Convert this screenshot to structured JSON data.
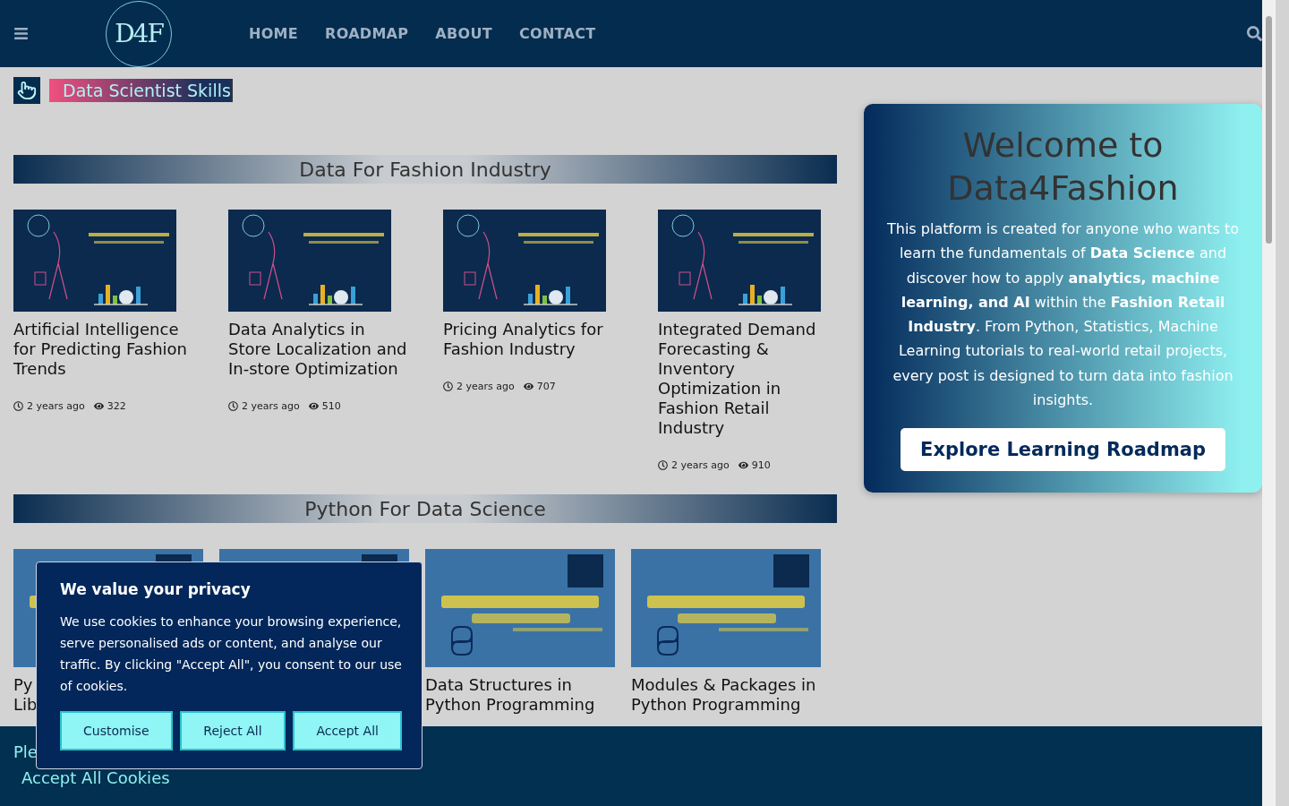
{
  "header": {
    "logo_text": "D4F",
    "nav": [
      {
        "label": "HOME"
      },
      {
        "label": "ROADMAP"
      },
      {
        "label": "ABOUT"
      },
      {
        "label": "CONTACT"
      }
    ]
  },
  "typed_banner": {
    "text": "Data Scientist Skills"
  },
  "sections": [
    {
      "title": "Data For Fashion Industry",
      "kind": "fashion",
      "posts": [
        {
          "kind": "post",
          "title": "Artificial Intelligence for Predicting Fashion Trends",
          "age": "2 years ago",
          "views": "322"
        },
        {
          "kind": "post",
          "title": "Data Analytics in Store Localization and In-store Optimization",
          "age": "2 years ago",
          "views": "510"
        },
        {
          "kind": "post",
          "title": "Pricing Analytics for Fashion Industry",
          "age": "2 years ago",
          "views": "707"
        },
        {
          "kind": "post",
          "title": "Integrated Demand Forecasting & Inventory Optimization in Fashion Retail Industry",
          "age": "2 years ago",
          "views": "910"
        }
      ]
    },
    {
      "title": "Python For Data Science",
      "kind": "python",
      "posts": [
        {
          "kind": "post",
          "title": "Py\nLib"
        },
        {
          "kind": "picture"
        },
        {
          "kind": "post",
          "title": "Data Structures in Python Programming"
        },
        {
          "kind": "post",
          "title": "Modules & Packages in Python Programming"
        }
      ]
    }
  ],
  "welcome": {
    "title": "Welcome to Data4Fashion",
    "body": "This platform is created for anyone who wants to learn the fundamentals of **Data Science** and discover how to apply **analytics, machine learning, and AI** within the **Fashion Retail Industry**. From Python, Statistics, Machine Learning tutorials to real-world retail projects, every post is designed to turn data into fashion insights.",
    "button": "Explore Learning Roadmap"
  },
  "cookie_banner": {
    "text": "Ple",
    "link": "Accept All Cookies"
  },
  "cookie_dialog": {
    "title": "We value your privacy",
    "body": "We use cookies to enhance your browsing experience, serve personalised ads or content, and analyse our traffic. By clicking \"Accept All\", you consent to our use of cookies.",
    "buttons": [
      {
        "label": "Customise"
      },
      {
        "label": "Reject All"
      },
      {
        "label": "Accept All"
      }
    ]
  }
}
